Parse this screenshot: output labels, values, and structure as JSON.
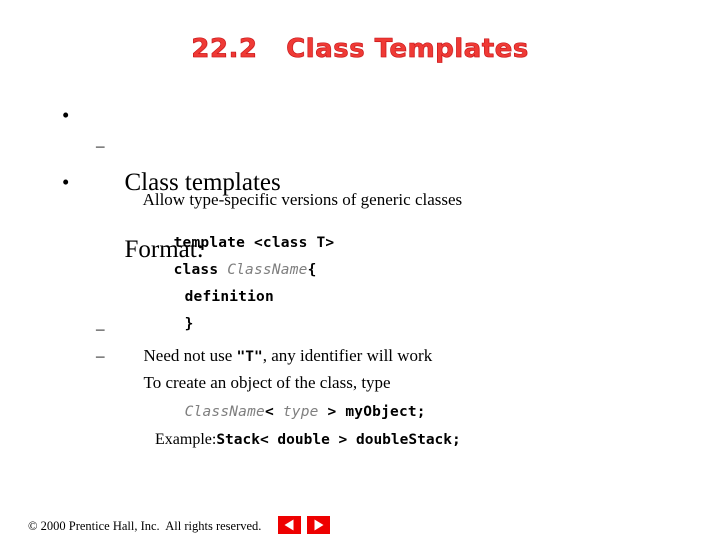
{
  "slide": {
    "title": "22.2   Class Templates",
    "title_color": "#ef3a35",
    "background": "#ffffff"
  },
  "body": {
    "bullet_glyph": "•",
    "dash_glyph": "–",
    "items": [
      {
        "level": 1,
        "text": "Class templates"
      },
      {
        "level": 2,
        "text": "Allow type-specific versions of generic classes"
      },
      {
        "level": 1,
        "text": "Format:"
      }
    ],
    "code_block": {
      "line1": "template <class T>",
      "line2_keyword": "class ",
      "line2_identifier": "ClassName",
      "line2_brace": "{",
      "line3": "definition",
      "line4": "}"
    },
    "notes": [
      {
        "prefix": "Need not use ",
        "code": "\"T\"",
        "suffix": ", any identifier will work"
      },
      {
        "prefix": "To create an object of the class, type",
        "code": "",
        "suffix": ""
      }
    ],
    "usage": {
      "identifier": "ClassName",
      "open_angle": "<",
      "type_placeholder": " type ",
      "close_angle": ">",
      "object_decl": " myObject;"
    },
    "example": {
      "label": "Example:",
      "code": "Stack< double > doubleStack;"
    },
    "placeholder_color": "#7f7f7f"
  },
  "footer": {
    "copyright": "© 2000 Prentice Hall, Inc.  All rights reserved.",
    "nav_prev_label": "Previous slide",
    "nav_next_label": "Next slide",
    "nav_color": "#ee0000"
  }
}
